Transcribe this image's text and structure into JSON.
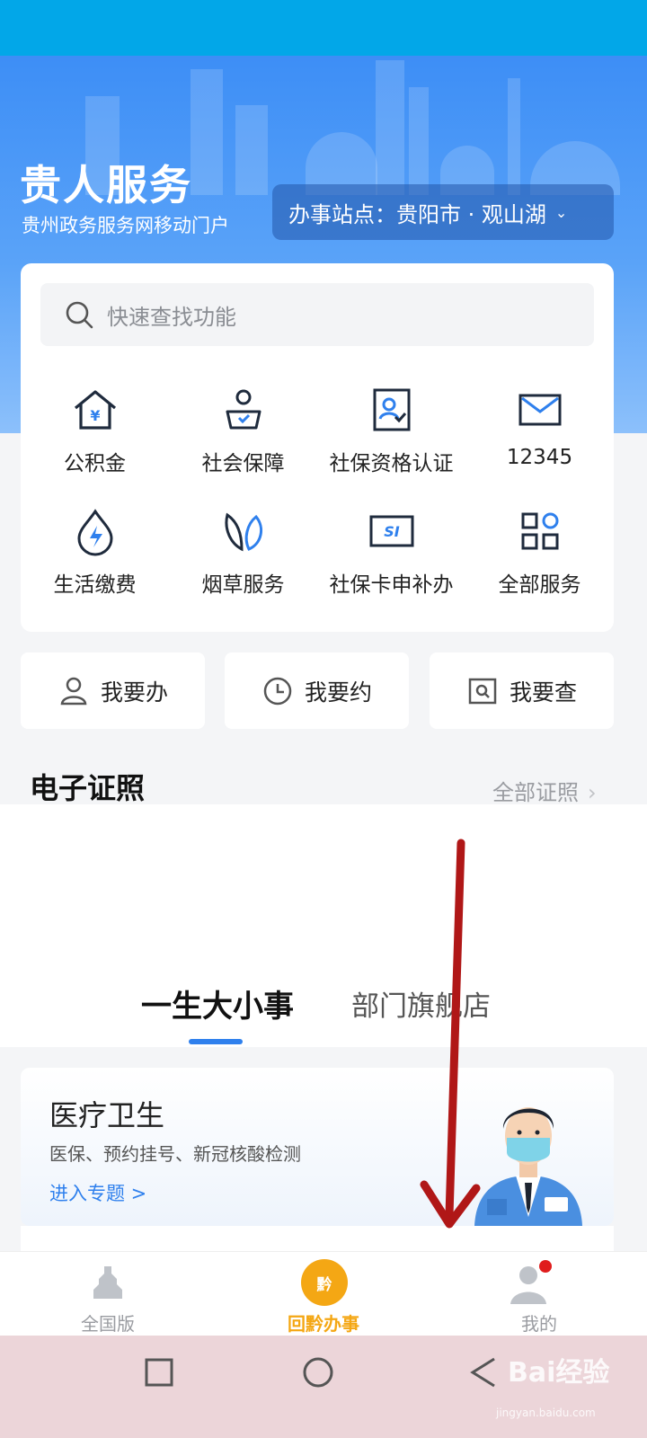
{
  "header": {
    "title": "贵人服务",
    "subtitle": "贵州政务服务网移动门户",
    "site_selector": "办事站点：贵阳市 · 观山湖"
  },
  "search": {
    "placeholder": "快速查找功能"
  },
  "services": [
    {
      "label": "公积金",
      "icon": "housing-fund-icon"
    },
    {
      "label": "社会保障",
      "icon": "social-security-icon"
    },
    {
      "label": "社保资格认证",
      "icon": "qualification-verify-icon"
    },
    {
      "label": "12345",
      "icon": "mail-icon"
    },
    {
      "label": "生活缴费",
      "icon": "utility-payment-icon"
    },
    {
      "label": "烟草服务",
      "icon": "tobacco-leaf-icon"
    },
    {
      "label": "社保卡申补办",
      "icon": "si-card-icon"
    },
    {
      "label": "全部服务",
      "icon": "grid-apps-icon"
    }
  ],
  "quick_actions": [
    {
      "label": "我要办",
      "icon": "person-icon"
    },
    {
      "label": "我要约",
      "icon": "clock-icon"
    },
    {
      "label": "我要查",
      "icon": "search-doc-icon"
    }
  ],
  "certificates": {
    "title": "电子证照",
    "all_link": "全部证照"
  },
  "tabs": [
    {
      "label": "一生大小事",
      "active": true
    },
    {
      "label": "部门旗舰店",
      "active": false
    }
  ],
  "topic": {
    "title": "医疗卫生",
    "description": "医保、预约挂号、新冠核酸检测",
    "link": "进入专题 >"
  },
  "bottom_nav": [
    {
      "label": "全国版",
      "icon": "national-icon"
    },
    {
      "label": "回黔办事",
      "icon": "qian-logo-icon",
      "badge_text": "黔"
    },
    {
      "label": "我的",
      "icon": "user-profile-icon",
      "has_dot": true
    }
  ],
  "watermark": {
    "text": "Bai经验",
    "sub": "jingyan.baidu.com"
  },
  "colors": {
    "accent": "#2f80ed",
    "status_bar": "#02a7e8",
    "nav_active": "#f4a714",
    "arrow": "#b01717"
  }
}
